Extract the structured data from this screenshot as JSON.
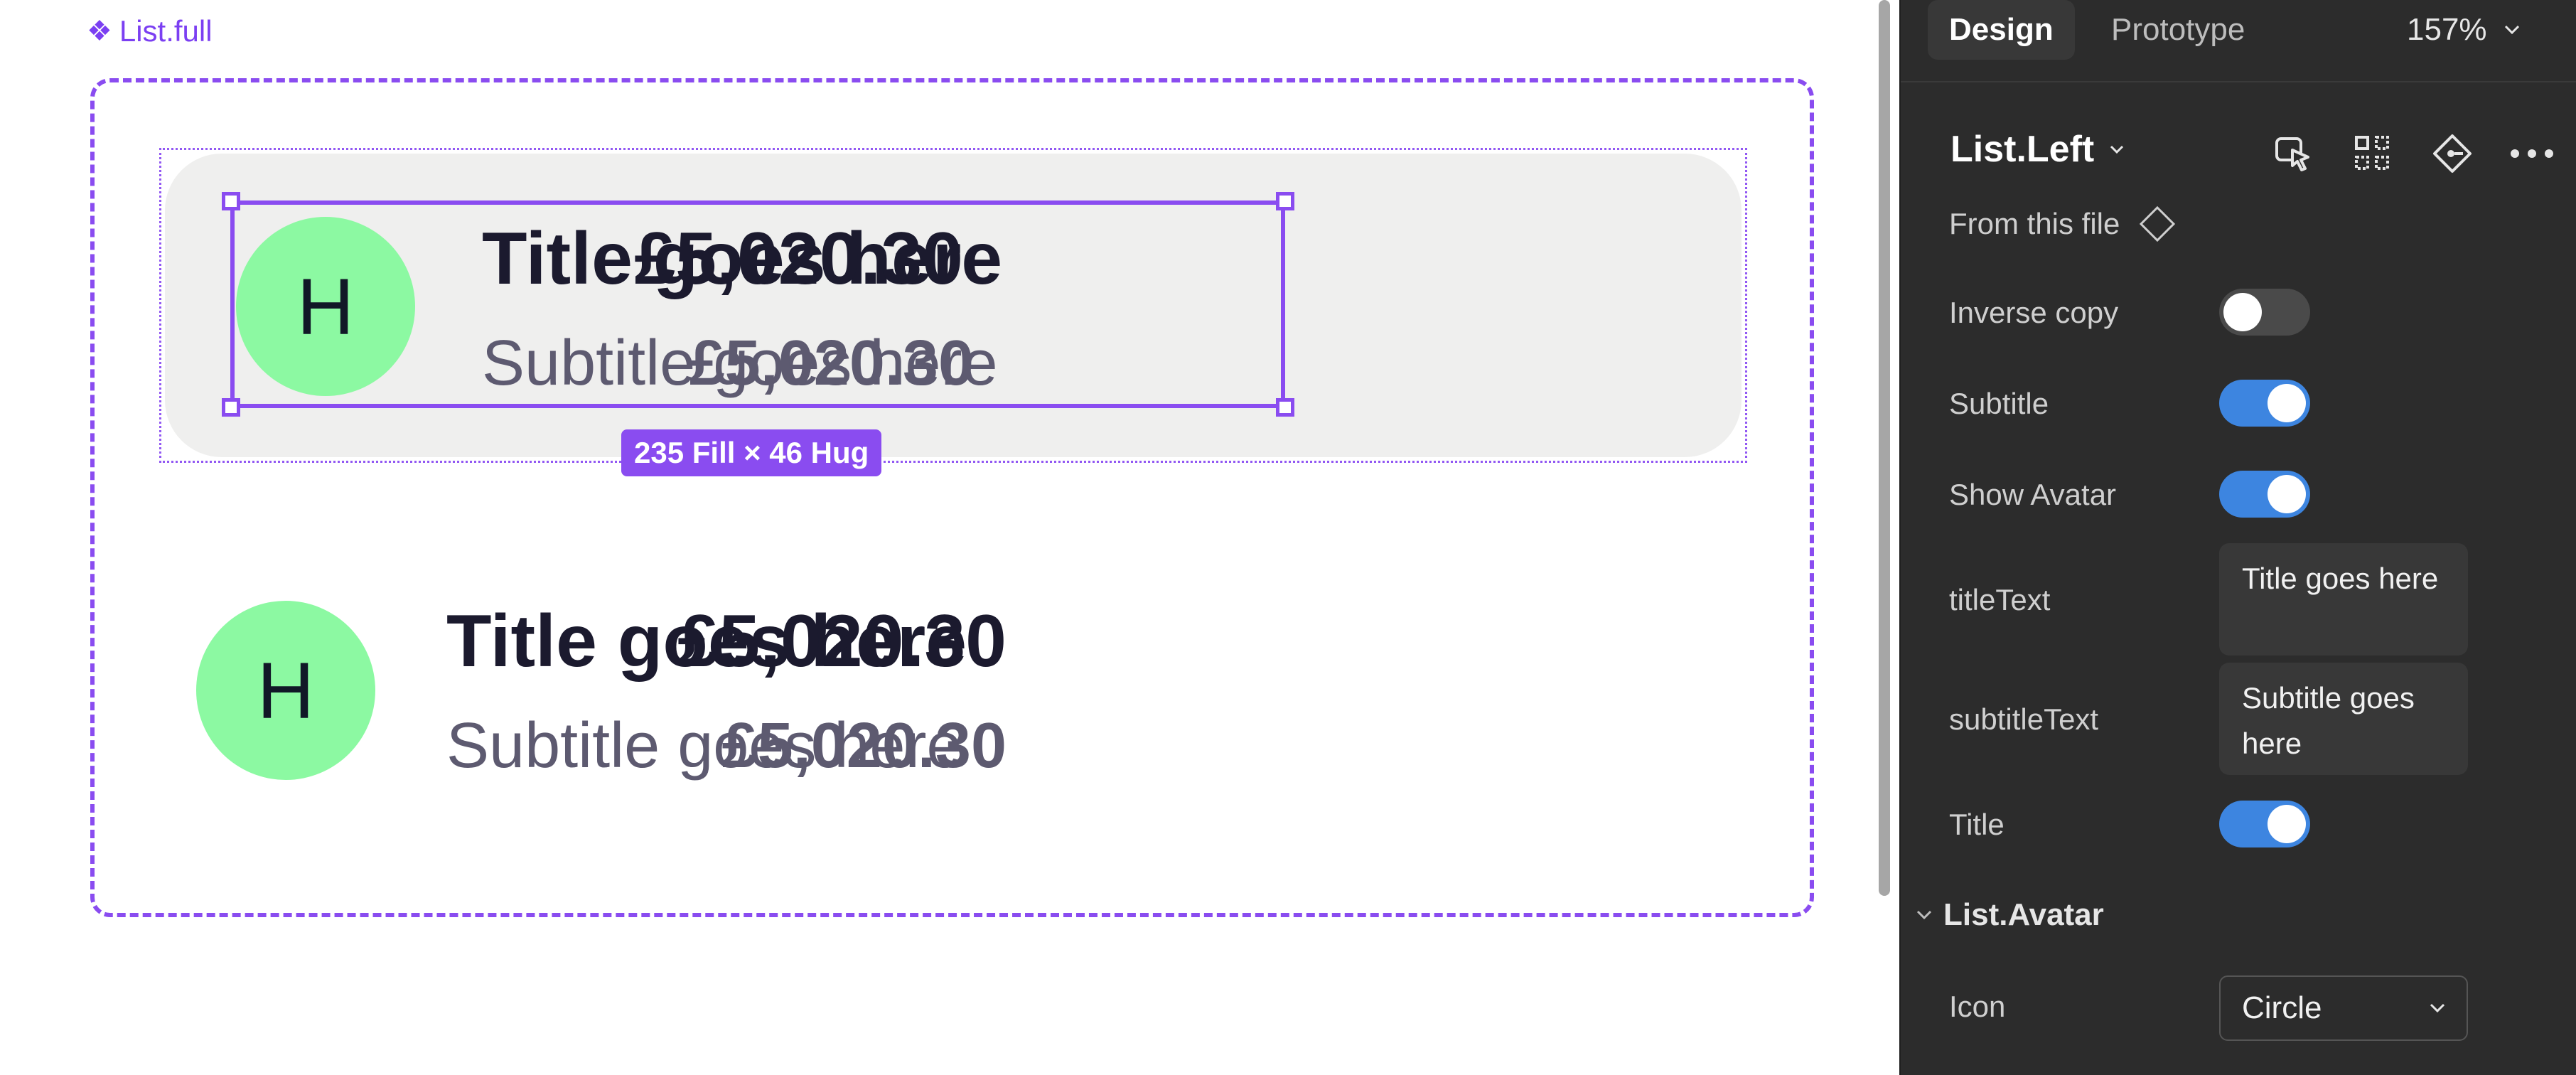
{
  "canvas": {
    "component_label": "List.full",
    "selection_size": "235 Fill × 46 Hug",
    "rows": [
      {
        "avatar_letter": "H",
        "title": "Title goes here",
        "subtitle": "Subtitle goes here",
        "amount": "£5,020.30",
        "amount_secondary": "£5,020.30"
      },
      {
        "avatar_letter": "H",
        "title": "Title goes here",
        "subtitle": "Subtitle goes here",
        "amount": "£5,020.30",
        "amount_secondary": "£5,020.30"
      }
    ]
  },
  "panel": {
    "tabs": [
      "Design",
      "Prototype"
    ],
    "zoom": "157%",
    "component_name": "List.Left",
    "from_this_file": "From this file",
    "props": {
      "inverse_copy": {
        "label": "Inverse copy",
        "value": false
      },
      "subtitle": {
        "label": "Subtitle",
        "value": true
      },
      "show_avatar": {
        "label": "Show Avatar",
        "value": true
      },
      "title_text": {
        "label": "titleText",
        "value": "Title goes here"
      },
      "subtitle_text": {
        "label": "subtitleText",
        "value": "Subtitle goes here"
      },
      "title": {
        "label": "Title",
        "value": true
      }
    },
    "section": "List.Avatar",
    "icon_label": "Icon",
    "icon_value": "Circle"
  },
  "colors": {
    "selection": "#8a4cf0",
    "avatar": "#8cf9a2",
    "toggle_on": "#3d85e0",
    "panel_bg": "#2c2c2c"
  }
}
